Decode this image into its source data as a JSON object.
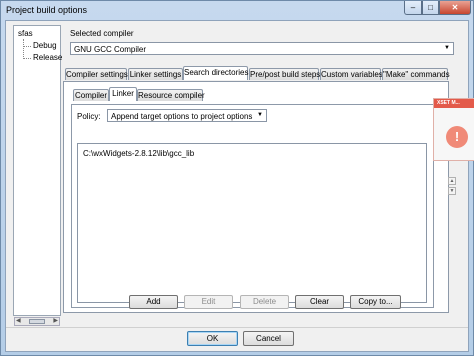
{
  "window": {
    "title": "Project build options",
    "close_glyph": "✕",
    "minimize_glyph": "–",
    "maximize_glyph": "□"
  },
  "tree": {
    "root": "sfas",
    "children": [
      "Debug",
      "Release"
    ]
  },
  "compiler": {
    "label": "Selected compiler",
    "value": "GNU GCC Compiler"
  },
  "tabs": [
    "Compiler settings",
    "Linker settings",
    "Search directories",
    "Pre/post build steps",
    "Custom variables",
    "\"Make\" commands"
  ],
  "active_tab": "Search directories",
  "subtabs": [
    "Compiler",
    "Linker",
    "Resource compiler"
  ],
  "active_subtab": "Linker",
  "policy": {
    "label": "Policy:",
    "value": "Append target options to project options"
  },
  "paths": [
    "C:\\wxWidgets-2.8.12\\lib\\gcc_lib"
  ],
  "buttons": {
    "add": "Add",
    "edit": "Edit",
    "delete": "Delete",
    "clear": "Clear",
    "copy_to": "Copy to..."
  },
  "dialog": {
    "ok": "OK",
    "cancel": "Cancel"
  },
  "overlay": {
    "header": "XSET M...",
    "icon": "!"
  },
  "colors": {
    "close_button": "#c7452f",
    "overlay_header": "#e35a4a",
    "warning_icon": "#f08a78"
  }
}
